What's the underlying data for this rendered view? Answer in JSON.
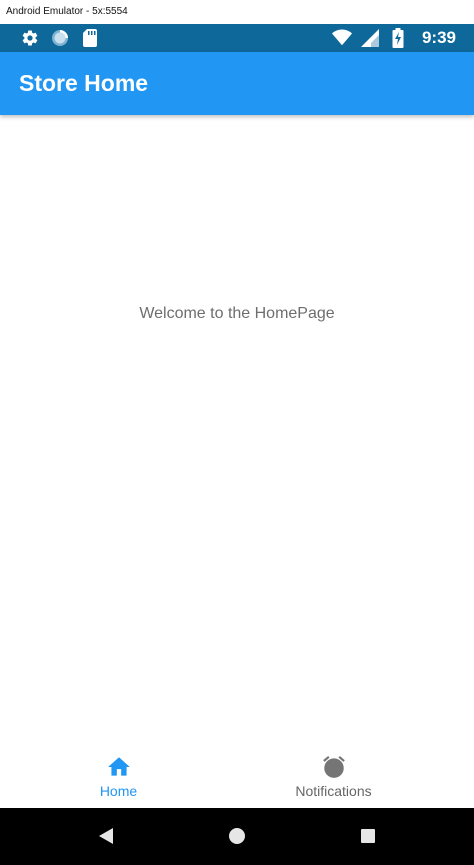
{
  "window": {
    "title": "Android Emulator - 5x:5554"
  },
  "status_bar": {
    "time": "9:39",
    "background": "#0f689a",
    "icons_left": [
      "gear-icon",
      "sync-icon",
      "sd-card-icon"
    ],
    "icons_right": [
      "wifi-icon",
      "signal-icon",
      "battery-charging-icon"
    ]
  },
  "app_bar": {
    "title": "Store Home",
    "background": "#2196f3"
  },
  "main": {
    "welcome_text": "Welcome to the HomePage"
  },
  "bottom_nav": {
    "tabs": [
      {
        "label": "Home",
        "icon": "home-icon",
        "selected": true,
        "color": "#2196f3"
      },
      {
        "label": "Notifications",
        "icon": "alarm-clock-icon",
        "selected": false,
        "color": "#666666"
      }
    ]
  },
  "system_nav": {
    "buttons": [
      "back-icon",
      "home-circle-icon",
      "recents-icon"
    ]
  }
}
